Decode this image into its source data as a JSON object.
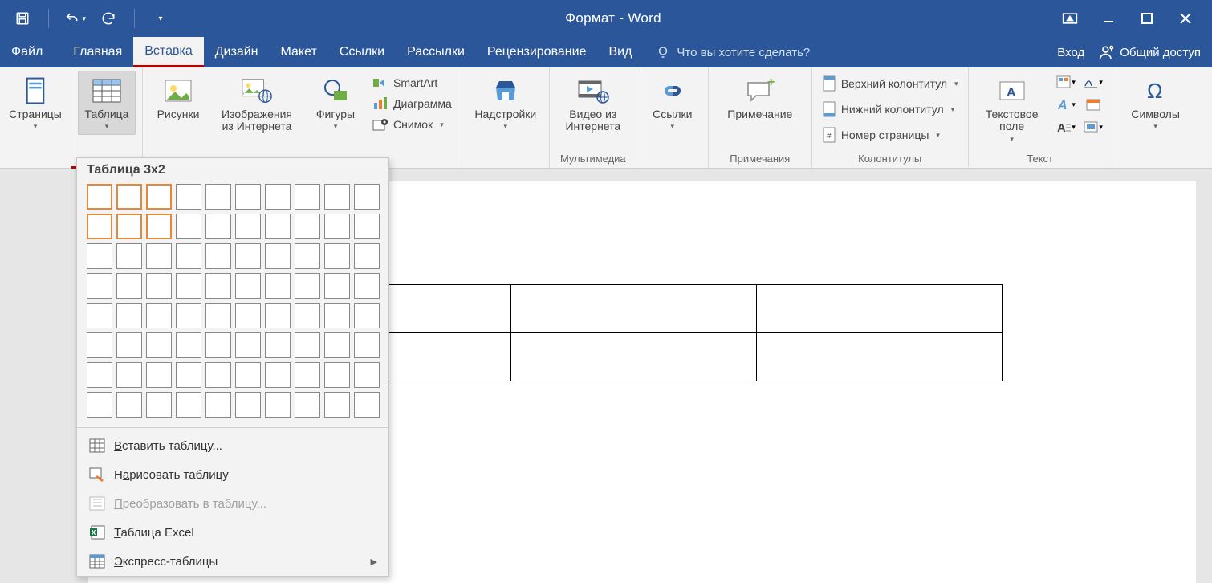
{
  "window": {
    "title": "Формат - Word"
  },
  "menubar": {
    "file": "Файл",
    "tabs": [
      "Главная",
      "Вставка",
      "Дизайн",
      "Макет",
      "Ссылки",
      "Рассылки",
      "Рецензирование",
      "Вид"
    ],
    "active_index": 1,
    "tell_me_placeholder": "Что вы хотите сделать?",
    "sign_in": "Вход",
    "share": "Общий доступ"
  },
  "ribbon": {
    "pages": {
      "label": "Страницы"
    },
    "tables": {
      "label": "Таблица"
    },
    "illustrations": {
      "pictures": "Рисунки",
      "online_pictures": "Изображения из Интернета",
      "shapes": "Фигуры",
      "smartart": "SmartArt",
      "chart": "Диаграмма",
      "screenshot": "Снимок"
    },
    "addins": {
      "label": "Надстройки"
    },
    "media": {
      "label": "Видео из Интернета",
      "group": "Мультимедиа"
    },
    "links": {
      "label": "Ссылки"
    },
    "comments": {
      "label": "Примечание",
      "group": "Примечания"
    },
    "headerfooter": {
      "header": "Верхний колонтитул",
      "footer": "Нижний колонтитул",
      "pagenum": "Номер страницы",
      "group": "Колонтитулы"
    },
    "text": {
      "textbox": "Текстовое поле",
      "group": "Текст"
    },
    "symbols": {
      "label": "Символы"
    }
  },
  "table_dropdown": {
    "title": "Таблица 3x2",
    "grid": {
      "cols": 10,
      "rows": 8,
      "sel_cols": 3,
      "sel_rows": 2
    },
    "items": {
      "insert": "Вставить таблицу...",
      "draw": "Нарисовать таблицу",
      "convert": "Преобразовать в таблицу...",
      "excel": "Таблица Excel",
      "quick": "Экспресс-таблицы"
    }
  },
  "icons": {
    "save": "save-icon",
    "undo": "undo-icon",
    "redo": "redo-icon",
    "more": "more-icon",
    "bulb": "bulb-icon",
    "person": "person-icon",
    "page": "page-icon",
    "table": "table-icon",
    "picture": "picture-icon",
    "online_picture": "online-picture-icon",
    "shapes": "shapes-icon",
    "smartart": "smartart-icon",
    "chart": "chart-icon",
    "screenshot": "screenshot-icon",
    "addins": "store-icon",
    "video": "video-icon",
    "link": "link-icon",
    "comment": "comment-icon",
    "header": "header-icon",
    "footer": "footer-icon",
    "pagenum": "pagenum-icon",
    "textbox": "textbox-icon",
    "omega": "omega-icon"
  }
}
